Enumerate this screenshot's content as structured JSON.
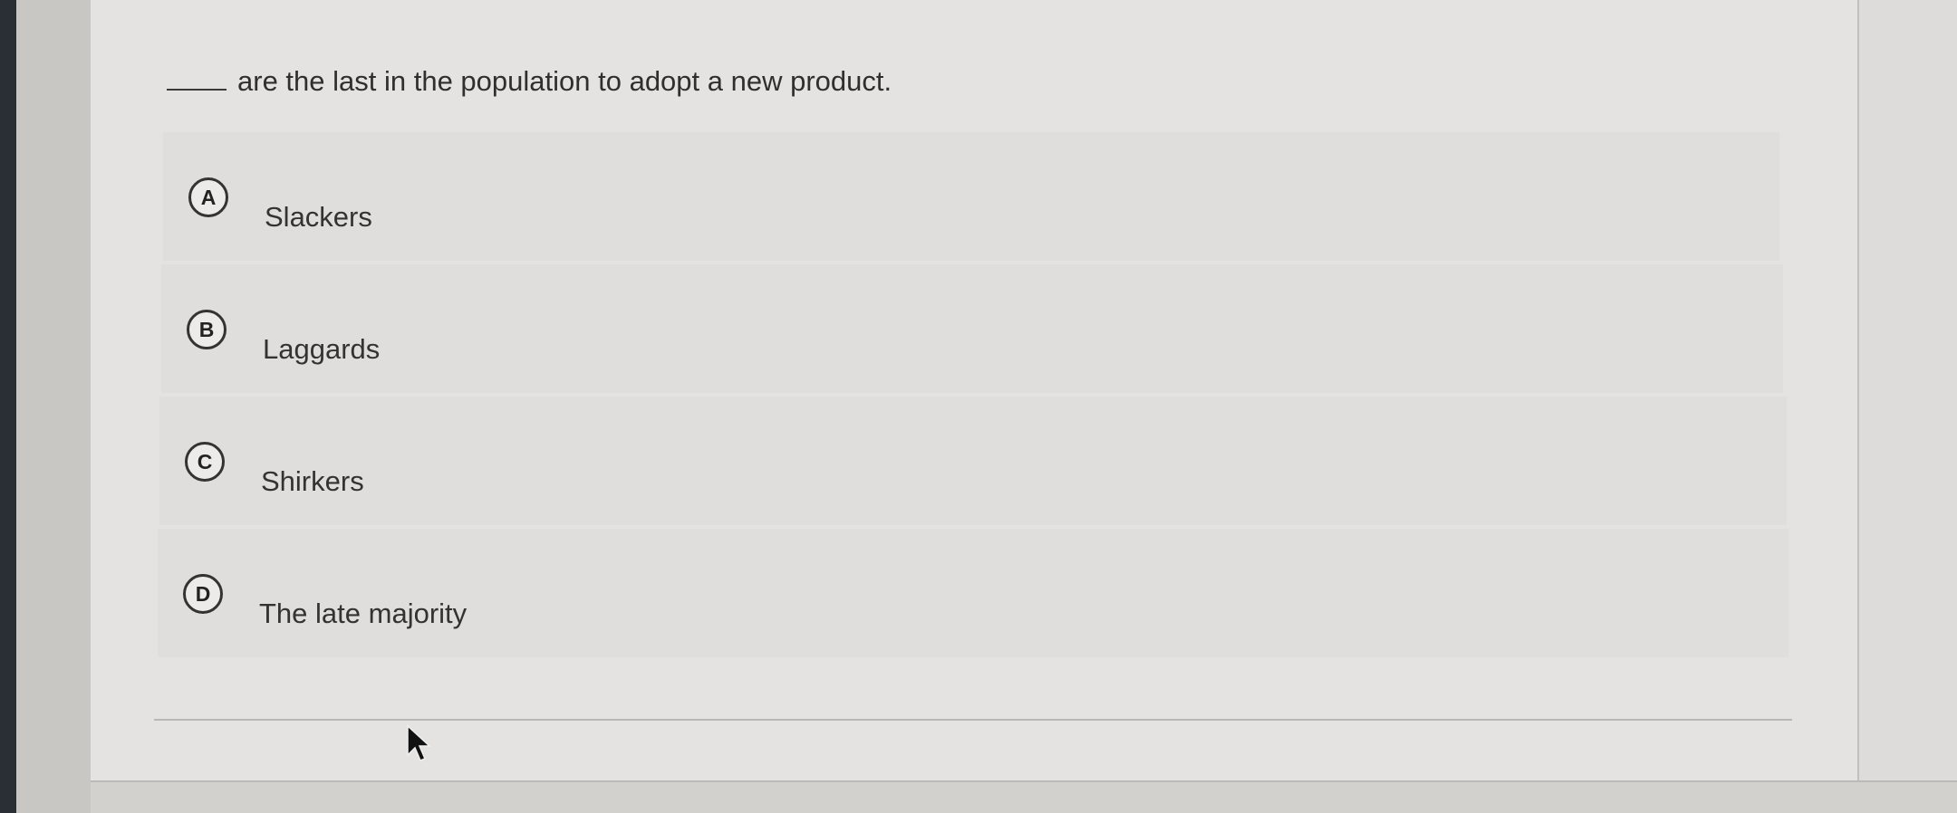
{
  "question": {
    "blank": "_____",
    "text": "are the last in the population to adopt a new product."
  },
  "options": [
    {
      "letter": "A",
      "label": "Slackers"
    },
    {
      "letter": "B",
      "label": "Laggards"
    },
    {
      "letter": "C",
      "label": "Shirkers"
    },
    {
      "letter": "D",
      "label": "The late majority"
    }
  ],
  "icons": {
    "cursor": "mouse-pointer-icon"
  },
  "colors": {
    "panel": "#e4e3e1",
    "option_bg": "#dfdedc",
    "text": "#333333"
  }
}
